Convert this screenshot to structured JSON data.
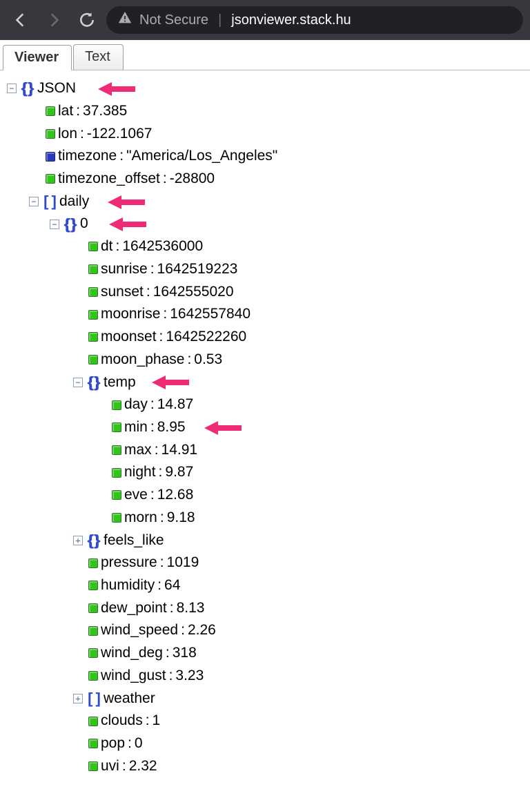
{
  "chrome": {
    "not_secure_label": "Not Secure",
    "domain": "jsonviewer.stack.hu"
  },
  "tabs": {
    "viewer": "Viewer",
    "text": "Text"
  },
  "tree": {
    "root_label": "JSON",
    "lat": {
      "k": "lat",
      "v": "37.385"
    },
    "lon": {
      "k": "lon",
      "v": "-122.1067"
    },
    "timezone": {
      "k": "timezone",
      "v": "\"America/Los_Angeles\""
    },
    "tz_offset": {
      "k": "timezone_offset",
      "v": "-28800"
    },
    "daily_label": "daily",
    "idx0_label": "0",
    "dt": {
      "k": "dt",
      "v": "1642536000"
    },
    "sunrise": {
      "k": "sunrise",
      "v": "1642519223"
    },
    "sunset": {
      "k": "sunset",
      "v": "1642555020"
    },
    "moonrise": {
      "k": "moonrise",
      "v": "1642557840"
    },
    "moonset": {
      "k": "moonset",
      "v": "1642522260"
    },
    "moon_phase": {
      "k": "moon_phase",
      "v": "0.53"
    },
    "temp_label": "temp",
    "temp": {
      "day": {
        "k": "day",
        "v": "14.87"
      },
      "min": {
        "k": "min",
        "v": "8.95"
      },
      "max": {
        "k": "max",
        "v": "14.91"
      },
      "night": {
        "k": "night",
        "v": "9.87"
      },
      "eve": {
        "k": "eve",
        "v": "12.68"
      },
      "morn": {
        "k": "morn",
        "v": "9.18"
      }
    },
    "feels_like_label": "feels_like",
    "pressure": {
      "k": "pressure",
      "v": "1019"
    },
    "humidity": {
      "k": "humidity",
      "v": "64"
    },
    "dew_point": {
      "k": "dew_point",
      "v": "8.13"
    },
    "wind_speed": {
      "k": "wind_speed",
      "v": "2.26"
    },
    "wind_deg": {
      "k": "wind_deg",
      "v": "318"
    },
    "wind_gust": {
      "k": "wind_gust",
      "v": "3.23"
    },
    "weather_label": "weather",
    "clouds": {
      "k": "clouds",
      "v": "1"
    },
    "pop": {
      "k": "pop",
      "v": "0"
    },
    "uvi": {
      "k": "uvi",
      "v": "2.32"
    }
  }
}
